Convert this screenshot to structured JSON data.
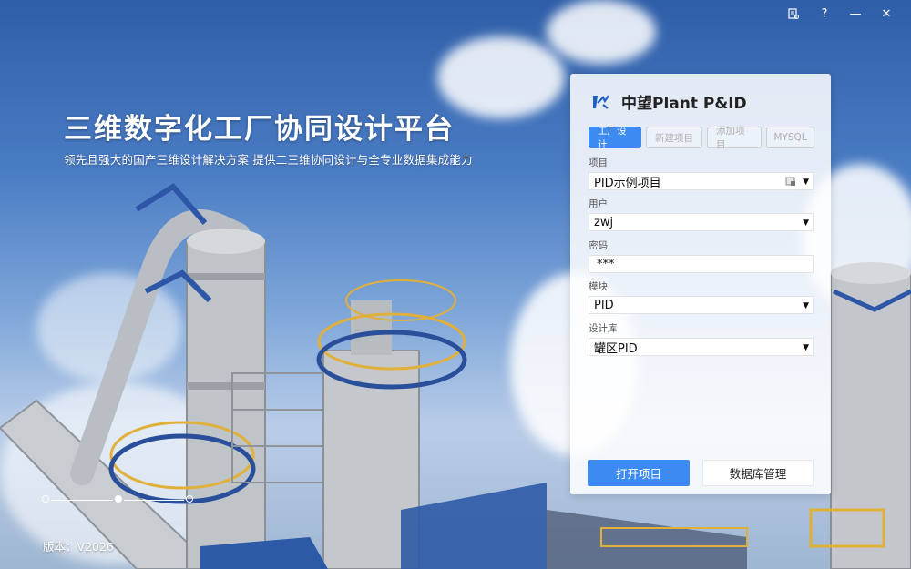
{
  "window_controls": {
    "settings_icon": "settings-doc-icon",
    "help": "?",
    "minimize": "—",
    "close": "✕"
  },
  "hero": {
    "title": "三维数字化工厂协同设计平台",
    "subtitle": "领先且强大的国产三维设计解决方案  提供二三维协同设计与全专业数据集成能力"
  },
  "carousel": {
    "count": 3,
    "active_index": 1
  },
  "version": {
    "label": "版本：",
    "value": "V2026"
  },
  "login_panel": {
    "brand": "中望Plant P&ID",
    "tabs": [
      "工厂设计",
      "新建项目",
      "添加项目",
      "MYSQL"
    ],
    "active_tab": "工厂设计",
    "fields": {
      "project_label": "项目",
      "project_value": "PID示例项目",
      "user_label": "用户",
      "user_value": "zwj",
      "password_label": "密码",
      "password_value": "***",
      "module_label": "模块",
      "module_value": "PID",
      "library_label": "设计库",
      "library_value": "罐区PID"
    },
    "open_button": "打开项目",
    "db_button": "数据库管理",
    "accent_color": "#3d8bf2"
  }
}
